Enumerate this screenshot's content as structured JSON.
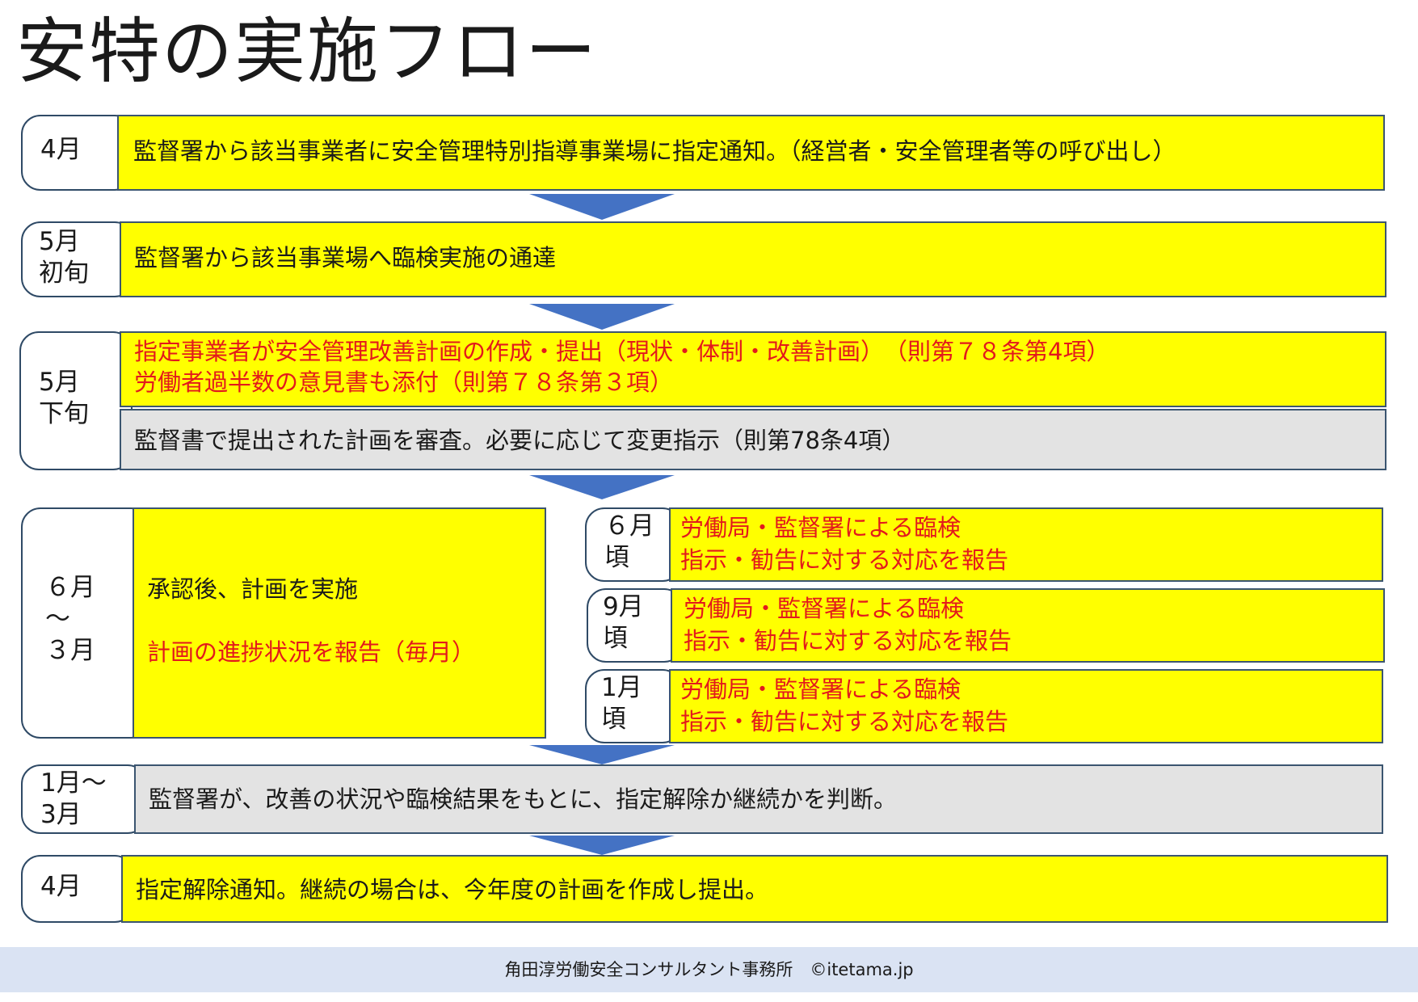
{
  "title": "安特の実施フロー",
  "steps": [
    {
      "label": "4月",
      "lines": [
        "監督署から該当事業者に安全管理特別指導事業場に指定通知。（経営者・安全管理者等の呼び出し）"
      ]
    },
    {
      "label": "5月\n初旬",
      "lines": [
        "監督署から該当事業場へ臨検実施の通達"
      ]
    },
    {
      "label": "5月\n下旬",
      "red_lines": [
        "指定事業者が安全管理改善計画の作成・提出（現状・体制・改善計画）　（則第７８条第4項）",
        "労働者過半数の意見書も添付（則第７８条第３項）"
      ],
      "gray_line": "監督書で提出された計画を審査。必要に応じて変更指示（則第78条4項）"
    },
    {
      "label": "６月\n～\n３月",
      "line1": "承認後、計画を実施",
      "line2": "計画の進捗状況を報告（毎月）"
    },
    {
      "label": "1月～\n3月",
      "lines": [
        "監督署が、改善の状況や臨検結果をもとに、指定解除か継続かを判断。"
      ]
    },
    {
      "label": "4月",
      "lines": [
        "指定解除通知。継続の場合は、今年度の計画を作成し提出。"
      ]
    }
  ],
  "inspections": [
    {
      "label": "６月\n頃",
      "line1": "労働局・監督署による臨検",
      "line2": "指示・勧告に対する対応を報告"
    },
    {
      "label": "9月\n頃",
      "line1": "労働局・監督署による臨検",
      "line2": "指示・勧告に対する対応を報告"
    },
    {
      "label": "1月\n頃",
      "line1": "労働局・監督署による臨検",
      "line2": "指示・勧告に対する対応を報告"
    }
  ],
  "footer": "角田淳労働安全コンサルタント事務所　©itetama.jp",
  "colors": {
    "yellow": "#ffff00",
    "gray": "#e3e3e3",
    "red": "#e3191c",
    "arrow": "#4472c4",
    "border": "#2f4a66",
    "footer_bg": "#dae3f3"
  }
}
